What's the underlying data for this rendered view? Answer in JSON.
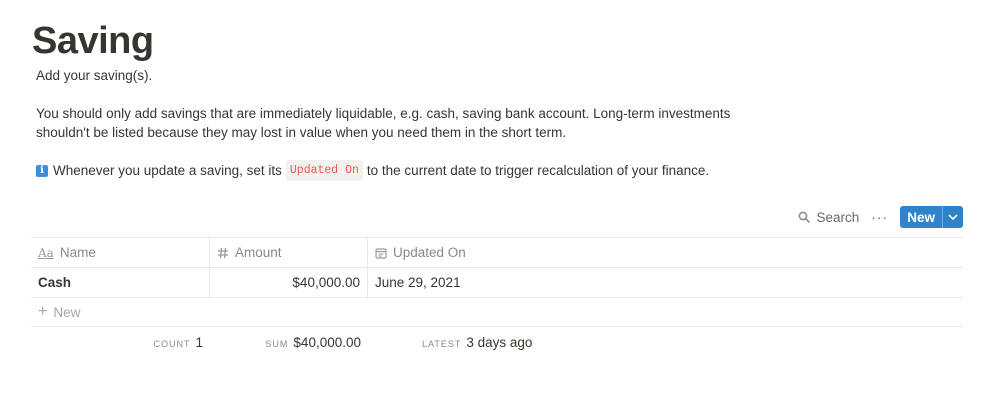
{
  "page": {
    "title": "Saving",
    "intro": "Add your saving(s).",
    "description": "You should only add savings that are immediately liquidable, e.g. cash, saving bank account. Long-term investments shouldn't be listed because they may lost in value when you need them in the short term.",
    "tip": {
      "icon": "info-icon",
      "before": "Whenever you update a saving, set its",
      "code": "Updated On",
      "after": "to the current date to trigger recalculation of your finance."
    }
  },
  "toolbar": {
    "search_label": "Search",
    "more_label": "···",
    "new_label": "New"
  },
  "table": {
    "columns": [
      {
        "label": "Name",
        "icon": "text-property-icon"
      },
      {
        "label": "Amount",
        "icon": "number-property-icon"
      },
      {
        "label": "Updated On",
        "icon": "date-property-icon"
      }
    ],
    "rows": [
      {
        "name": "Cash",
        "amount": "$40,000.00",
        "updated_on": "June 29, 2021"
      }
    ],
    "new_row_label": "New",
    "footer": {
      "count_key": "COUNT",
      "count_value": "1",
      "sum_key": "SUM",
      "sum_value": "$40,000.00",
      "latest_key": "LATEST",
      "latest_value": "3 days ago"
    }
  },
  "colors": {
    "accent": "#2f83c8",
    "code_text": "#eb5757",
    "text": "#37352f"
  }
}
